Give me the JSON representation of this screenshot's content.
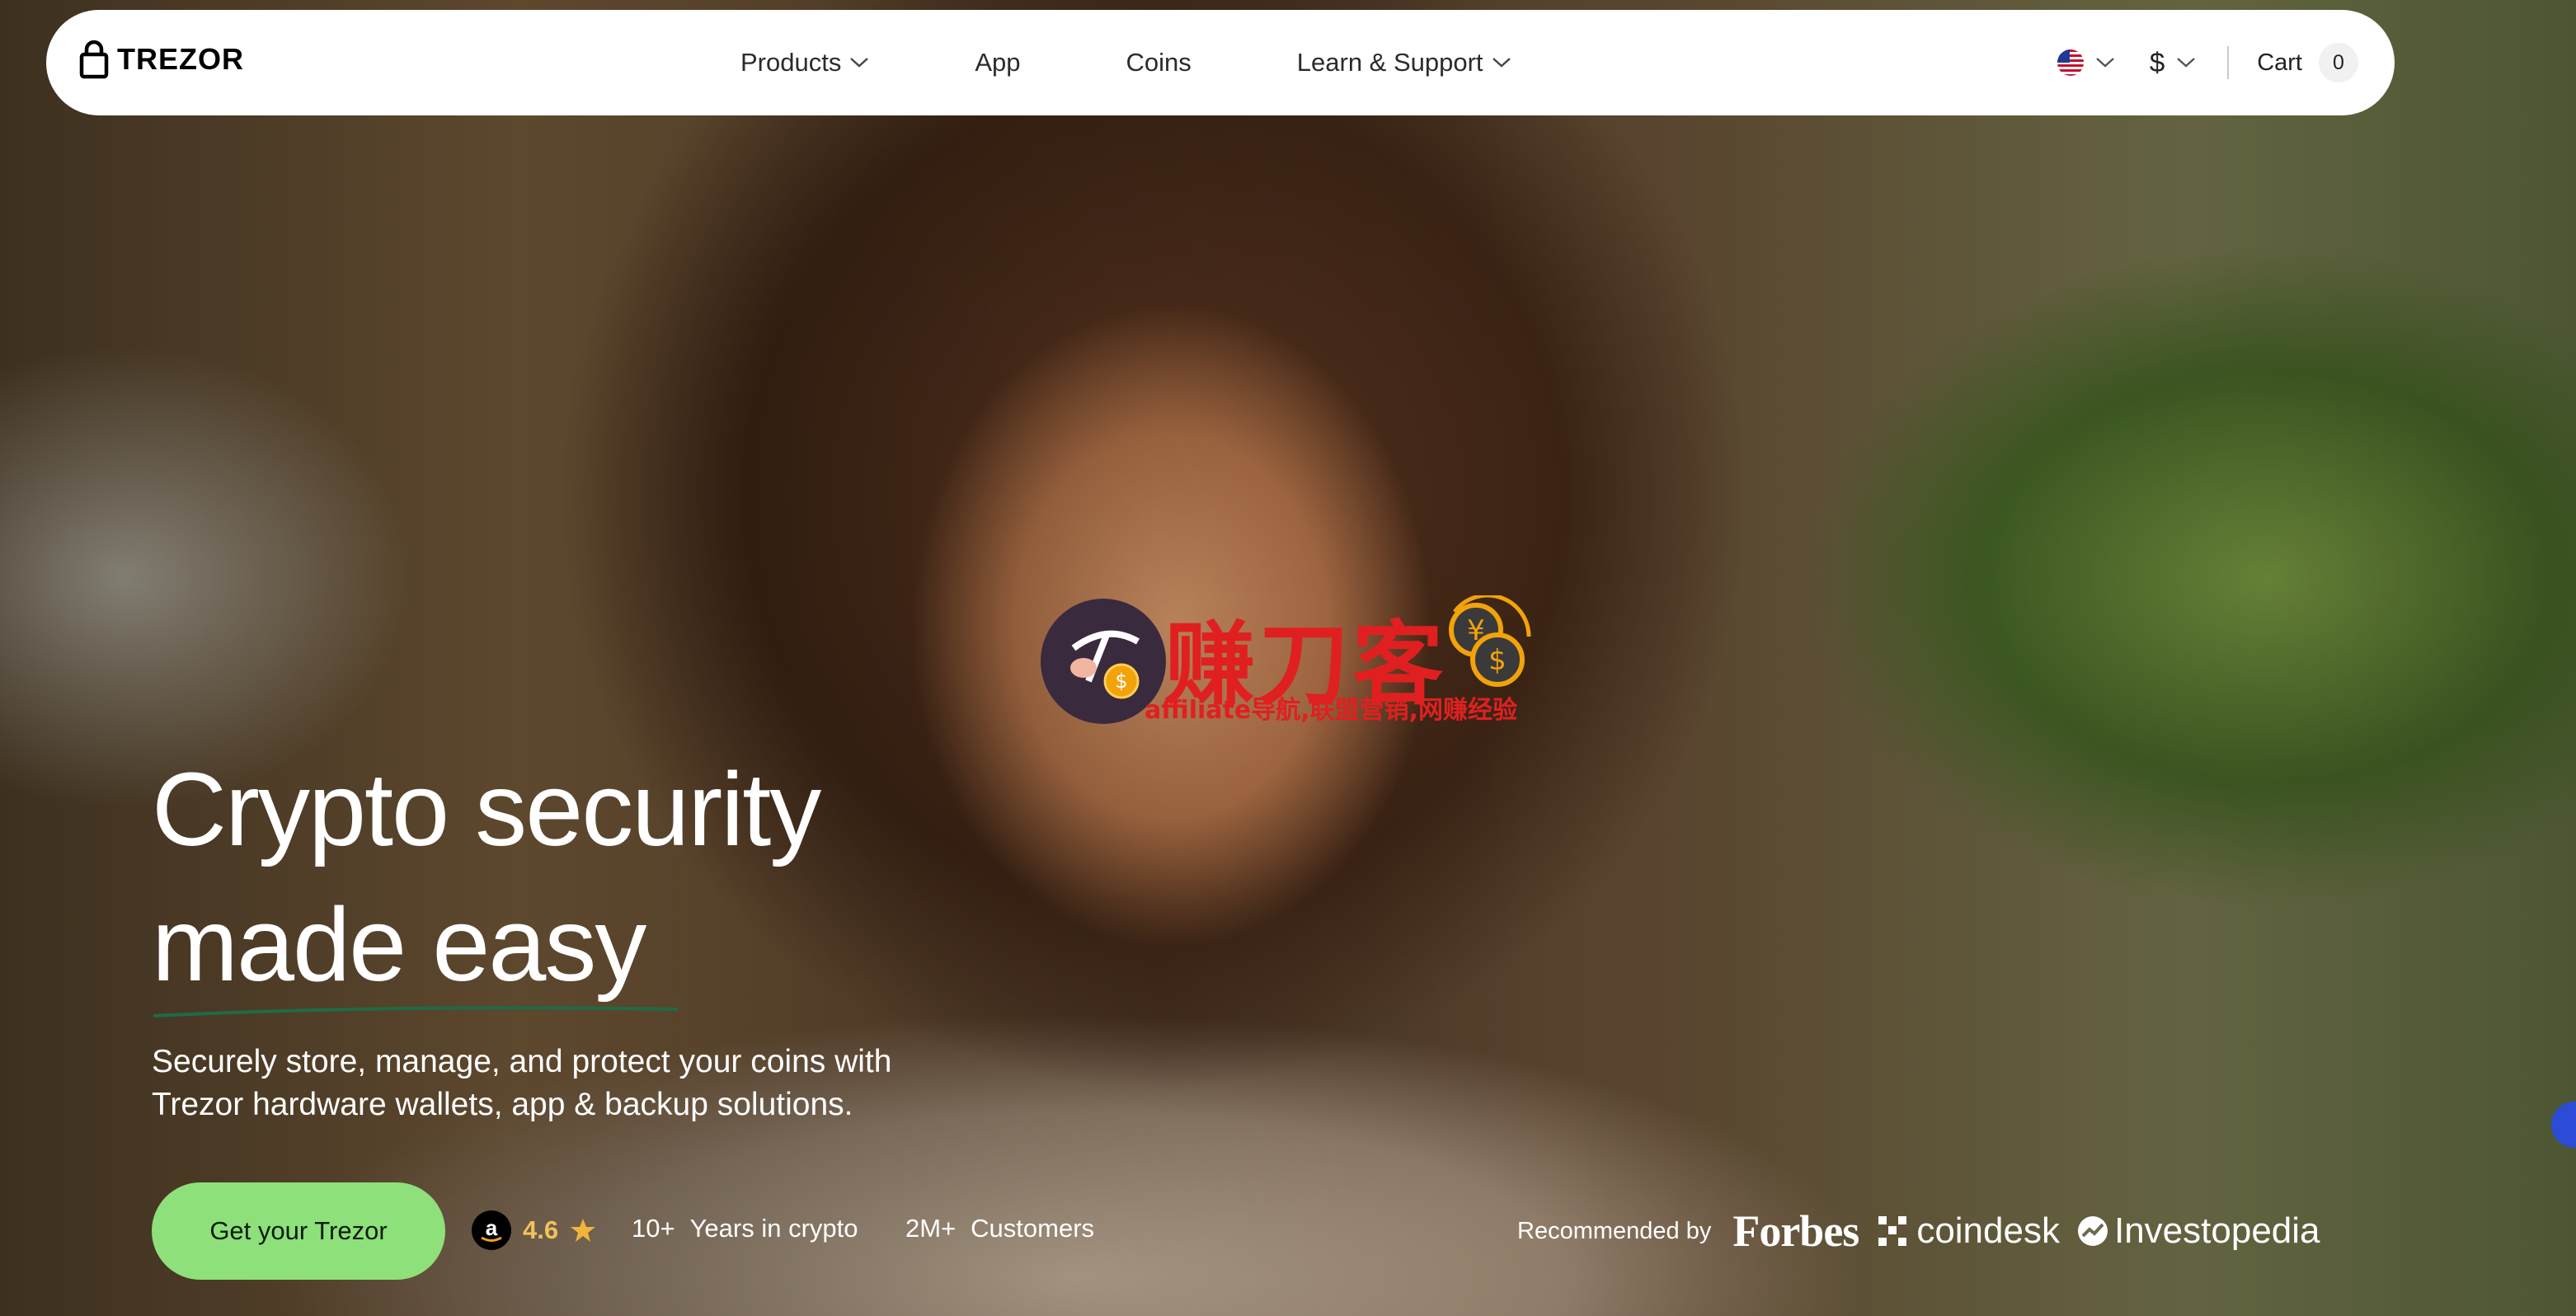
{
  "brand": {
    "logo_text": "TREZOR"
  },
  "nav": {
    "items": [
      {
        "label": "Products",
        "has_dropdown": true
      },
      {
        "label": "App",
        "has_dropdown": false
      },
      {
        "label": "Coins",
        "has_dropdown": false
      },
      {
        "label": "Learn & Support",
        "has_dropdown": true
      }
    ],
    "region": {
      "flag": "us-flag-icon"
    },
    "currency": {
      "symbol": "$"
    },
    "cart": {
      "label": "Cart",
      "count": "0"
    }
  },
  "hero": {
    "headline_line1": "Crypto security",
    "headline_line2": "made easy",
    "subtitle_line1": "Securely store, manage, and protect your coins with",
    "subtitle_line2": "Trezor hardware wallets, app & backup solutions.",
    "cta_label": "Get your Trezor",
    "rating": {
      "source_icon": "amazon-icon",
      "value": "4.6"
    },
    "stats": [
      {
        "value": "10+",
        "label": "Years in crypto"
      },
      {
        "value": "2M+",
        "label": "Customers"
      }
    ],
    "press": {
      "label": "Recommended by",
      "outlets": [
        "Forbes",
        "coindesk",
        "Investopedia"
      ]
    }
  },
  "watermark": {
    "title": "赚刀客",
    "subtitle": "affiliate导航,联盟营销,网赚经验"
  },
  "colors": {
    "nav_bg": "#ffffff",
    "cta_bg": "#8ee07a",
    "headline_underline": "#1f6b45",
    "rating_star": "#f0b43a",
    "watermark_red": "#e02020"
  }
}
